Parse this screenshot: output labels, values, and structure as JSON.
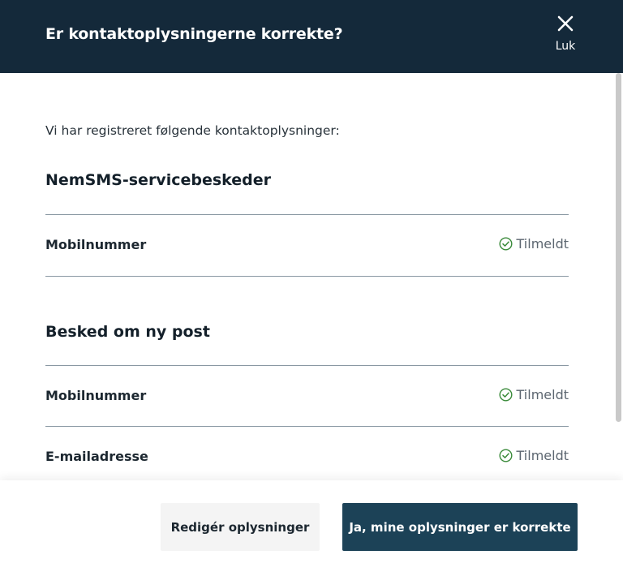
{
  "header": {
    "title": "Er kontaktoplysningerne korrekte?",
    "close_label": "Luk"
  },
  "body": {
    "intro": "Vi har registreret følgende kontaktoplysninger:",
    "sections": [
      {
        "title": "NemSMS-servicebeskeder",
        "rows": [
          {
            "label": "Mobilnummer",
            "status": "Tilmeldt"
          }
        ]
      },
      {
        "title": "Besked om ny post",
        "rows": [
          {
            "label": "Mobilnummer",
            "status": "Tilmeldt"
          },
          {
            "label": "E-mailadresse",
            "status": "Tilmeldt"
          }
        ]
      }
    ]
  },
  "footer": {
    "edit_label": "Redigér oplysninger",
    "confirm_label": "Ja, mine oplysninger er korrekte"
  },
  "colors": {
    "header_bg": "#14293a",
    "primary_button": "#1c4257",
    "status_icon": "#3a8a3a"
  },
  "icons": {
    "close": "close-icon",
    "status": "check-circle-icon"
  }
}
